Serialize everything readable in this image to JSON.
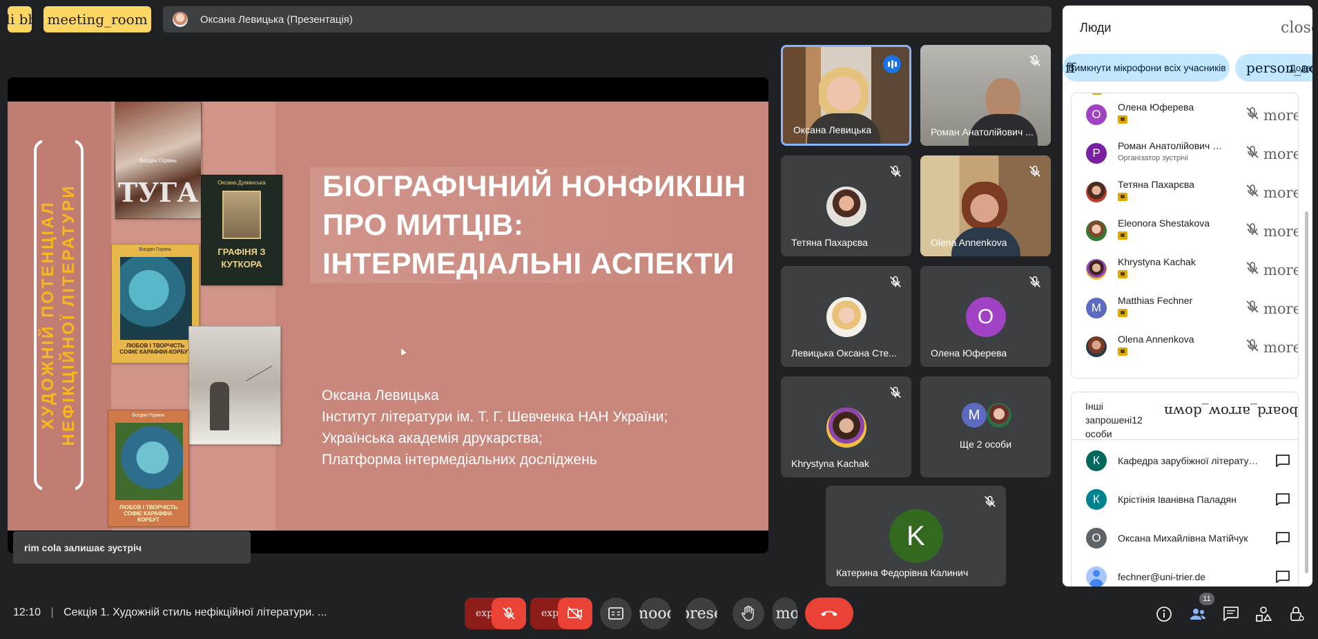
{
  "top_bar": {
    "left_icon_fallback": "n_di bbed",
    "meeting_room_label": "meeting_room",
    "presenter_title": "Оксана Левицька (Презентація)"
  },
  "slide": {
    "vertical_text_line1": "ХУДОЖНІЙ ПОТЕНЦІАЛ",
    "vertical_text_line2": "НЕФІКЦІЙНОЇ ЛІТЕРАТУРИ",
    "title_lines": [
      "БІОГРАФІЧНИЙ НОНФИКШН",
      "ПРО МИТЦІВ:",
      "ІНТЕРМЕДІАЛЬНІ АСПЕКТИ"
    ],
    "author_lines": [
      "Оксана Левицька",
      "Інститут літератури ім. Т. Г. Шевченка НАН України;",
      "Українська академія друкарства;",
      "Платформа інтермедіальних досліджень"
    ],
    "books": {
      "book1_author": "Богдан Горинь",
      "book1_title": "ТУГА",
      "book2_author": "Оксана Думанська",
      "book2_title": "ГРАФІНЯ З КУТКОРА",
      "book3_author": "Богдан Горинь",
      "book3_title": "ЛЮБОВ І ТВОРЧІСТЬ СОФІЄ КАРАФФИ-КОРБУТ",
      "book5_author": "Богдан Горинь",
      "book5_title": "ЛЮБОВ І ТВОРЧІСТЬ СОФІЄ КАРАФФИ-КОРБУТ"
    }
  },
  "toast": {
    "text": "rim cola залишає зустріч"
  },
  "tiles": [
    {
      "name": "Оксана Левицька",
      "speaking": true
    },
    {
      "name": "Роман Анатолійович ...",
      "muted": true
    },
    {
      "name": "Тетяна Пахарєва",
      "muted": true
    },
    {
      "name": "Olena Annenkova",
      "muted": true
    },
    {
      "name": "Левицька Оксана Сте...",
      "muted": true
    },
    {
      "name": "Олена Юферева",
      "muted": true,
      "letter": "О",
      "color": "#a142c4"
    },
    {
      "name": "Khrystyna Kachak",
      "muted": true
    },
    {
      "name": "Ще 2 особи",
      "letter": "M",
      "color": "#5c6bc0"
    },
    {
      "name": "Катерина Федорівна Калинич",
      "muted": true,
      "letter": "K",
      "color": "#33691e"
    }
  ],
  "people_panel": {
    "title": "Люди",
    "close_label": "close",
    "mute_all_prefix": "ff",
    "mute_all_label": "Вимкнути мікрофони всіх учасників",
    "person_add_label": "person_add",
    "add_people_label": "Додати",
    "more_label": "more_vert",
    "participants": [
      {
        "name": "Олена Юферева",
        "letter": "О",
        "color": "#a142c4"
      },
      {
        "name": "Роман Анатолійович Дз...",
        "role": "Організатор зустрічі",
        "letter": "Р",
        "color": "#7b1fa2"
      },
      {
        "name": "Тетяна Пахарєва",
        "photo": true
      },
      {
        "name": "Eleonora Shestakova",
        "photo": true
      },
      {
        "name": "Khrystyna Kachak",
        "photo": true
      },
      {
        "name": "Matthias Fechner",
        "letter": "M",
        "color": "#5c6bc0"
      },
      {
        "name": "Olena Annenkova",
        "photo": true
      }
    ],
    "invited_heading": "Інші запрошені12 особи",
    "invited_toggle_label": "keyboard_arrow_down",
    "invited": [
      {
        "name": "Кафедра зарубіжної літератури...",
        "letter": "К",
        "color": "#00695c"
      },
      {
        "name": "Крістінія Іванівна Паладян",
        "letter": "К",
        "color": "#00838f"
      },
      {
        "name": "Оксана Михайлівна Матійчук",
        "letter": "О",
        "color": "#5f6368"
      },
      {
        "name": "fechner@uni-trier.de",
        "letter": "",
        "color": "#8ab4f8"
      }
    ]
  },
  "bottom_bar": {
    "time": "12:10",
    "separator": "|",
    "meeting_title": "Секція 1. Художній стиль нефікційної літератури. ...",
    "expand_label": "expa",
    "mood_label": "mood",
    "present_label": "prese",
    "more_label": "_ mor",
    "participants_count": "11"
  }
}
